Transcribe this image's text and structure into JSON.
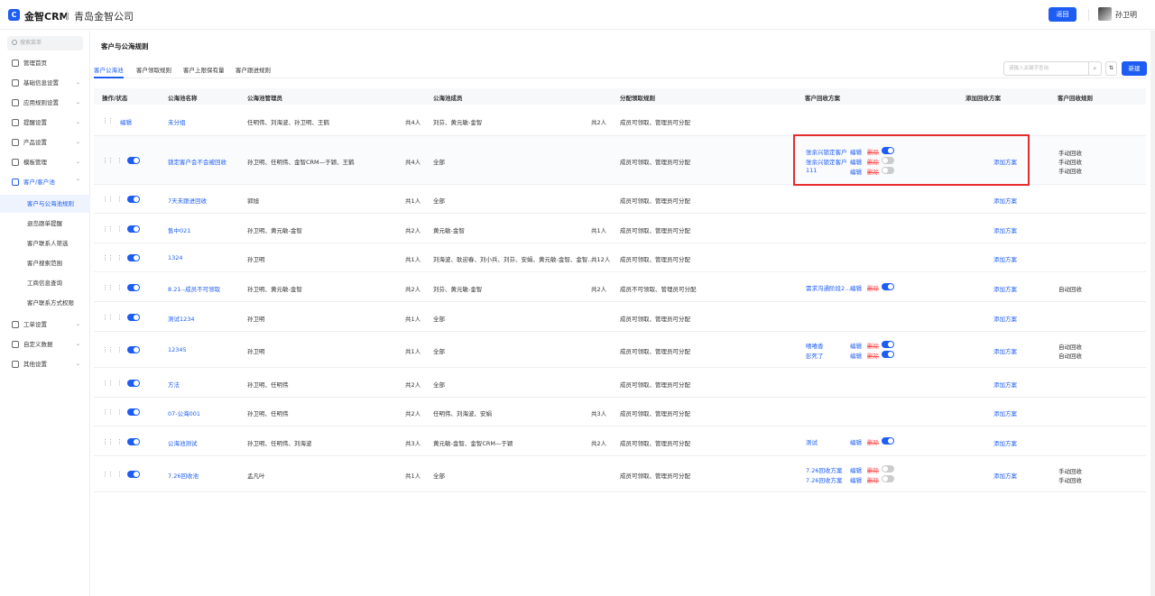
{
  "brand": {
    "logo_text": "C",
    "name": "金智CRM",
    "company": "青岛金智公司"
  },
  "header": {
    "back_label": "返回",
    "user_name": "孙卫明"
  },
  "sidebar": {
    "search_placeholder": "搜索菜单",
    "items": [
      {
        "label": "管理首页",
        "icon": "home-icon"
      },
      {
        "label": "基础信息设置",
        "icon": "gear-icon"
      },
      {
        "label": "应用规则设置",
        "icon": "rules-icon"
      },
      {
        "label": "提醒设置",
        "icon": "bell-icon"
      },
      {
        "label": "产品设置",
        "icon": "box-icon"
      },
      {
        "label": "模板管理",
        "icon": "template-icon"
      },
      {
        "label": "客户/客户池",
        "icon": "user-icon"
      },
      {
        "label": "客户与公海池规则"
      },
      {
        "label": "退岛跟单提醒"
      },
      {
        "label": "客户联系人筛选"
      },
      {
        "label": "客户搜索范围"
      },
      {
        "label": "工商信息查询"
      },
      {
        "label": "客户联系方式权限"
      },
      {
        "label": "工单设置",
        "icon": "ticket-icon"
      },
      {
        "label": "自定义数据",
        "icon": "data-icon"
      },
      {
        "label": "其他设置",
        "icon": "grid-icon"
      }
    ]
  },
  "page": {
    "title": "客户与公海规则",
    "tabs": [
      "客户公海池",
      "客户领取规则",
      "客户上限保有量",
      "客户跟进规则"
    ],
    "search_placeholder": "请输入关键字查询",
    "new_label": "新建",
    "sort_icon": "sort-icon"
  },
  "table": {
    "headers": [
      "操作/状态",
      "公海池名称",
      "公海池管理员",
      "公海池成员",
      "分配领取规则",
      "客户回收方案",
      "添加回收方案",
      "客户回收规则"
    ],
    "rows": [
      {
        "edit": "编辑",
        "name": "未分组",
        "admins": "任明伟、刘海波、孙卫明、王鹤",
        "admin_count": "共4人",
        "members": "刘芬、黄元敏-金智",
        "member_count": "共2人",
        "rule": "成员可领取、管理员可分配",
        "plans": [],
        "add": "",
        "recycle": []
      },
      {
        "toggle": true,
        "name": "锁定客户会不会被回收",
        "admins": "孙卫明、任明伟、金智CRM—于颖、王鹤",
        "admin_count": "共4人",
        "members": "全部",
        "member_count": "",
        "rule": "成员可领取、管理员可分配",
        "plans": [
          {
            "name": "张余兴锁定客户",
            "edit": "编辑",
            "del": "删除",
            "on": true
          },
          {
            "name": "张余兴锁定客户",
            "edit": "编辑",
            "del": "删除",
            "on": false
          },
          {
            "name": "111",
            "edit": "编辑",
            "del": "删除",
            "on": false
          }
        ],
        "add": "添加方案",
        "recycle": [
          "手动回收",
          "手动回收",
          "手动回收"
        ]
      },
      {
        "toggle": true,
        "name": "7天未跟进回收",
        "admins": "郭旭",
        "admin_count": "共1人",
        "members": "全部",
        "member_count": "",
        "rule": "成员可领取、管理员可分配",
        "plans": [],
        "add": "添加方案",
        "recycle": []
      },
      {
        "toggle": true,
        "name": "售中021",
        "admins": "孙卫明、黄元敏-金智",
        "admin_count": "共2人",
        "members": "黄元敏-金智",
        "member_count": "共1人",
        "rule": "成员可领取、管理员可分配",
        "plans": [],
        "add": "添加方案",
        "recycle": []
      },
      {
        "toggle": true,
        "name": "1324",
        "admins": "孙卫明",
        "admin_count": "共1人",
        "members": "刘海波、耿迎春、刘小兵、刘芬、安娟、黄元敏-金智、金智…",
        "member_count": "共12人",
        "rule": "成员可领取、管理员可分配",
        "plans": [],
        "add": "添加方案",
        "recycle": []
      },
      {
        "toggle": true,
        "name": "8.21--成员不可领取",
        "admins": "孙卫明、黄元敏-金智",
        "admin_count": "共2人",
        "members": "刘芬、黄元敏-金智",
        "member_count": "共2人",
        "rule": "成员不可领取、管理员可分配",
        "plans": [
          {
            "name": "需求沟通阶段2…",
            "edit": "编辑",
            "del": "删除",
            "on": true
          }
        ],
        "add": "添加方案",
        "recycle": [
          "自动回收"
        ]
      },
      {
        "toggle": true,
        "name": "测试1234",
        "admins": "孙卫明",
        "admin_count": "共1人",
        "members": "全部",
        "member_count": "",
        "rule": "成员可领取、管理员可分配",
        "plans": [],
        "add": "添加方案",
        "recycle": []
      },
      {
        "toggle": true,
        "name": "12345",
        "admins": "孙卫明",
        "admin_count": "共1人",
        "members": "全部",
        "member_count": "",
        "rule": "成员可领取、管理员可分配",
        "plans": [
          {
            "name": "嘻嘻香",
            "edit": "编辑",
            "del": "删除",
            "on": true
          },
          {
            "name": "彭死了",
            "edit": "编辑",
            "del": "删除",
            "on": true
          }
        ],
        "add": "添加方案",
        "recycle": [
          "自动回收",
          "自动回收"
        ]
      },
      {
        "toggle": true,
        "name": "方法",
        "admins": "孙卫明、任明伟",
        "admin_count": "共2人",
        "members": "全部",
        "member_count": "",
        "rule": "成员可领取、管理员可分配",
        "plans": [],
        "add": "添加方案",
        "recycle": []
      },
      {
        "toggle": true,
        "name": "07-公海001",
        "admins": "孙卫明、任明伟",
        "admin_count": "共2人",
        "members": "任明伟、刘海波、安娟",
        "member_count": "共3人",
        "rule": "成员可领取、管理员可分配",
        "plans": [],
        "add": "添加方案",
        "recycle": []
      },
      {
        "toggle": true,
        "name": "公海池测试",
        "admins": "孙卫明、任明伟、刘海波",
        "admin_count": "共3人",
        "members": "黄元敏-金智、金智CRM—于颖",
        "member_count": "共2人",
        "rule": "成员可领取、管理员可分配",
        "plans": [
          {
            "name": "测试",
            "edit": "编辑",
            "del": "删除",
            "on": true
          }
        ],
        "add": "添加方案",
        "recycle": []
      },
      {
        "toggle": true,
        "name": "7.26回收池",
        "admins": "孟凡叶",
        "admin_count": "共1人",
        "members": "全部",
        "member_count": "",
        "rule": "成员可领取、管理员可分配",
        "plans": [
          {
            "name": "7.26回收方案",
            "edit": "编辑",
            "del": "删除",
            "on": false
          },
          {
            "name": "7.26回收方案",
            "edit": "编辑",
            "del": "删除",
            "on": false
          }
        ],
        "add": "添加方案",
        "recycle": [
          "手动回收",
          "手动回收"
        ]
      }
    ]
  },
  "colors": {
    "accent": "#1d5df3",
    "danger": "#ff4d4f",
    "highlight_box": "#e52b2b"
  }
}
